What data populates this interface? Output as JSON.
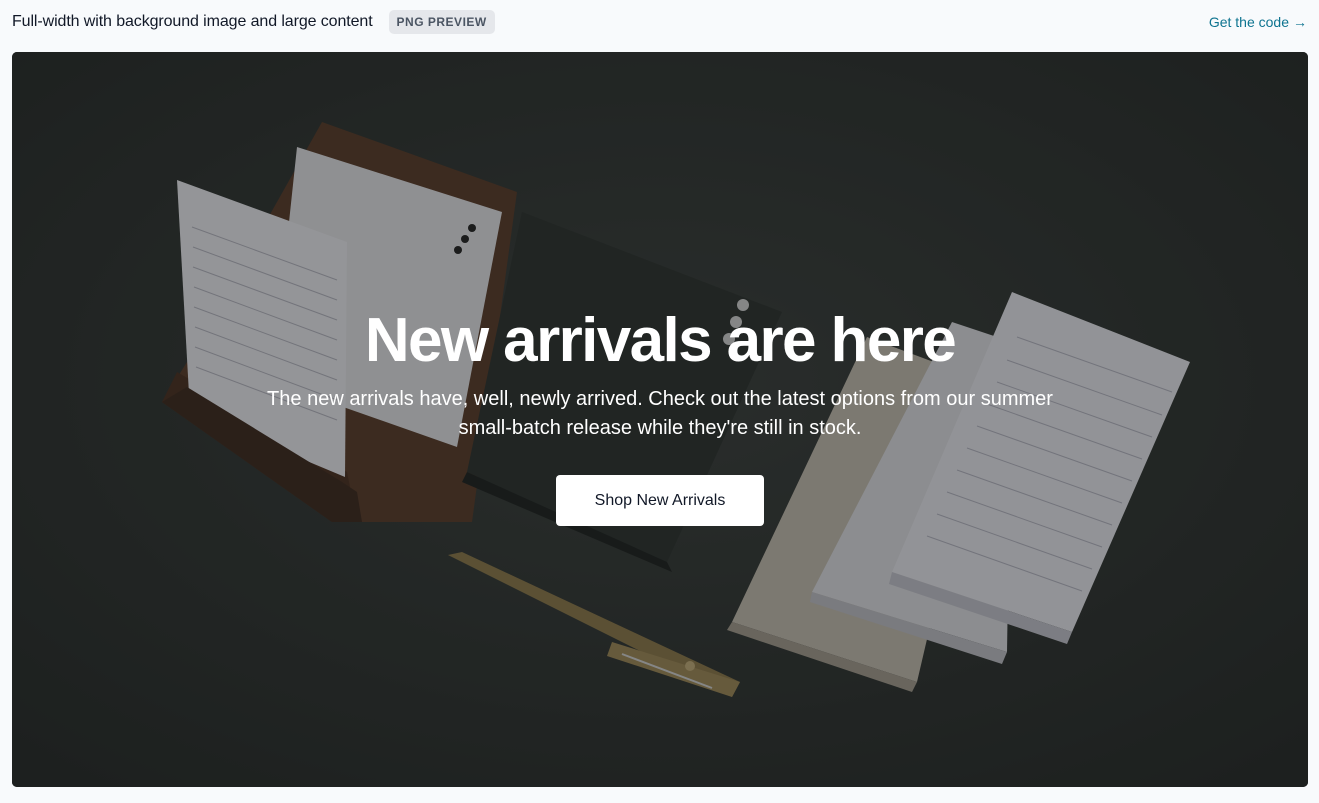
{
  "header": {
    "title": "Full-width with background image and large content",
    "badge": "PNG PREVIEW",
    "link_label": "Get the code",
    "link_arrow": "→"
  },
  "hero": {
    "headline": "New arrivals are here",
    "subtext": "The new arrivals have, well, newly arrived. Check out the latest options from our summer small-batch release while they're still in stock.",
    "cta_label": "Shop New Arrivals"
  },
  "colors": {
    "link": "#0e7490",
    "badge_bg": "#e5e7eb",
    "hero_bg": "#2c302e"
  }
}
